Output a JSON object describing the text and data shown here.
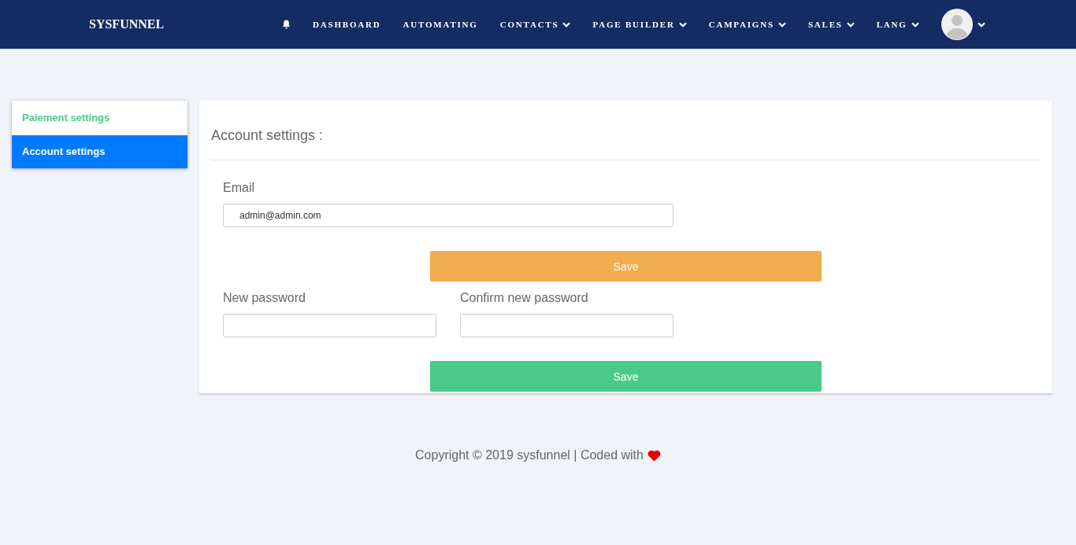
{
  "header": {
    "brand": "SYSFUNNEL",
    "nav": [
      {
        "kind": "bell"
      },
      {
        "kind": "link",
        "label": "DASHBOARD",
        "dropdown": false
      },
      {
        "kind": "link",
        "label": "AUTOMATING",
        "dropdown": false
      },
      {
        "kind": "link",
        "label": "CONTACTS",
        "dropdown": true
      },
      {
        "kind": "link",
        "label": "PAGE BUILDER",
        "dropdown": true
      },
      {
        "kind": "link",
        "label": "CAMPAIGNS",
        "dropdown": true
      },
      {
        "kind": "link",
        "label": "SALES",
        "dropdown": true
      },
      {
        "kind": "link",
        "label": "LANG",
        "dropdown": true
      },
      {
        "kind": "avatar",
        "dropdown": true
      }
    ]
  },
  "sidebar": {
    "items": [
      {
        "label": "Paiement settings",
        "selected": false
      },
      {
        "label": "Account settings",
        "selected": true
      }
    ]
  },
  "card": {
    "title": "Account settings :",
    "email": {
      "label": "Email",
      "value": "admin@admin.com"
    },
    "email_save": {
      "label": "Save",
      "color": "#f0ad4e"
    },
    "new_password": {
      "label": "New password"
    },
    "confirm_password": {
      "label": "Confirm new password"
    },
    "password_save": {
      "label": "Save",
      "color": "#4bca87"
    }
  },
  "footer": {
    "text": "Copyright © 2019 sysfunnel | Coded with"
  }
}
